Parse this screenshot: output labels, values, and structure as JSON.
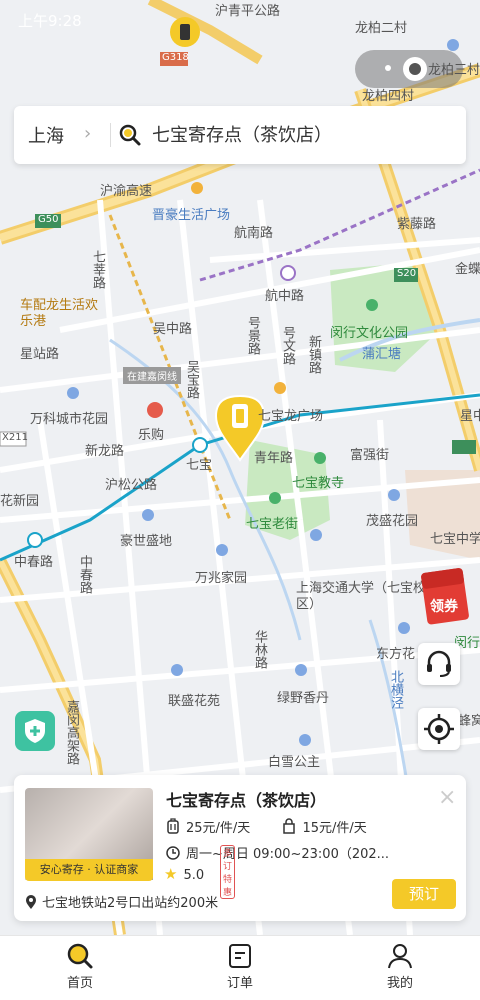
{
  "status": {
    "time": "上午9:28"
  },
  "search": {
    "city": "上海",
    "city_chevron": "›",
    "query": "七宝寄存点（茶饮店）"
  },
  "map_labels": [
    {
      "text": "龙柏二村",
      "class": ""
    },
    {
      "text": "龙柏三村",
      "class": ""
    },
    {
      "text": "龙柏四村",
      "class": ""
    },
    {
      "text": "沪青平公路",
      "class": ""
    },
    {
      "text": "G318",
      "class": ""
    },
    {
      "text": "沪渝高速",
      "class": ""
    },
    {
      "text": "G50",
      "class": ""
    },
    {
      "text": "晋豪生活广场",
      "class": "blue"
    },
    {
      "text": "航南路",
      "class": ""
    },
    {
      "text": "紫藤路",
      "class": ""
    },
    {
      "text": "S20",
      "class": ""
    },
    {
      "text": "金蝶",
      "class": ""
    },
    {
      "text": "车配龙生活欢乐港",
      "class": "orange"
    },
    {
      "text": "星站路",
      "class": ""
    },
    {
      "text": "吴中路",
      "class": ""
    },
    {
      "text": "航中路",
      "class": ""
    },
    {
      "text": "闵行文化公园",
      "class": "green"
    },
    {
      "text": "蒲汇塘",
      "class": "blue"
    },
    {
      "text": "在建嘉闵线",
      "class": ""
    },
    {
      "text": "万科城市花园",
      "class": ""
    },
    {
      "text": "乐购",
      "class": ""
    },
    {
      "text": "新龙路",
      "class": ""
    },
    {
      "text": "七宝",
      "class": ""
    },
    {
      "text": "七宝龙广场",
      "class": ""
    },
    {
      "text": "青年路",
      "class": ""
    },
    {
      "text": "富强街",
      "class": ""
    },
    {
      "text": "七宝教寺",
      "class": "green"
    },
    {
      "text": "花新园",
      "class": ""
    },
    {
      "text": "沪松公路",
      "class": ""
    },
    {
      "text": "茂盛花园",
      "class": ""
    },
    {
      "text": "七宝中学",
      "class": ""
    },
    {
      "text": "豪世盛地",
      "class": ""
    },
    {
      "text": "七宝老街",
      "class": "green"
    },
    {
      "text": "中春路",
      "class": ""
    },
    {
      "text": "万兆家园",
      "class": ""
    },
    {
      "text": "上海交通大学（七宝校区）",
      "class": ""
    },
    {
      "text": "东方花",
      "class": ""
    },
    {
      "text": "华林路",
      "class": ""
    },
    {
      "text": "北横泾",
      "class": "blue"
    },
    {
      "text": "联盛花苑",
      "class": ""
    },
    {
      "text": "绿野香丹",
      "class": ""
    },
    {
      "text": "嘉闵高架路",
      "class": ""
    },
    {
      "text": "白雪公主",
      "class": ""
    },
    {
      "text": "X211",
      "class": ""
    },
    {
      "text": "闵行",
      "class": ""
    },
    {
      "text": "蜂窝",
      "class": ""
    },
    {
      "text": "星中",
      "class": ""
    },
    {
      "text": "中春路",
      "class": ""
    },
    {
      "text": "七莘路",
      "class": ""
    },
    {
      "text": "吴宝路",
      "class": ""
    },
    {
      "text": "号景路",
      "class": ""
    },
    {
      "text": "号文路",
      "class": ""
    },
    {
      "text": "新镇路",
      "class": ""
    }
  ],
  "coupon": {
    "label": "领券"
  },
  "card": {
    "photo_badge": "安心寄存 · 认证商家",
    "title": "七宝寄存点（茶饮店）",
    "price_luggage": "25元/件/天",
    "price_bag": "15元/件/天",
    "hours": "周一~周日 09:00~23:00（202...",
    "discount_tag": "多订特惠",
    "rating": "5.0",
    "address": "七宝地铁站2号口出站约200米",
    "book_label": "预订",
    "close": "×"
  },
  "tabs": [
    {
      "label": "首页"
    },
    {
      "label": "订单"
    },
    {
      "label": "我的"
    }
  ],
  "colors": {
    "accent": "#f4c928",
    "metro": "#1aa3c9",
    "park": "#c9e9c1",
    "water": "#bcd6f1"
  }
}
